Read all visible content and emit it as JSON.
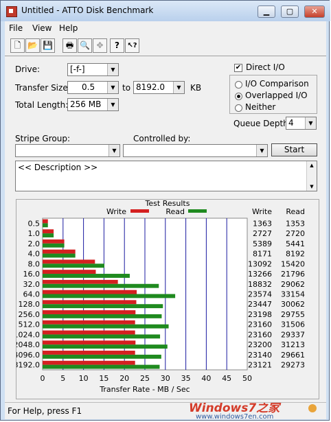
{
  "window": {
    "title": "Untitled - ATTO Disk Benchmark"
  },
  "menu": {
    "file": "File",
    "view": "View",
    "help": "Help"
  },
  "toolbar": {
    "icons": [
      "new-document-icon",
      "open-folder-icon",
      "save-icon",
      "print-icon",
      "print-preview-icon",
      "move-icon",
      "help-icon",
      "context-help-icon"
    ],
    "glyphs": [
      "🗋",
      "📂",
      "💾",
      "🖶",
      "🔍",
      "✥",
      "?",
      "↖?"
    ]
  },
  "form": {
    "drive_label": "Drive:",
    "drive_value": "[-f-]",
    "transfer_size_label": "Transfer Size:",
    "transfer_from": "0.5",
    "to_label": "to",
    "transfer_to": "8192.0",
    "kb_label": "KB",
    "total_length_label": "Total Length:",
    "total_length_value": "256 MB",
    "direct_io_label": "Direct I/O",
    "direct_io_checked": true,
    "io_comparison_label": "I/O Comparison",
    "overlapped_io_label": "Overlapped I/O",
    "neither_label": "Neither",
    "selected_mode": "Overlapped I/O",
    "queue_depth_label": "Queue Depth:",
    "queue_depth_value": "4",
    "stripe_group_label": "Stripe Group:",
    "controlled_by_label": "Controlled by:",
    "start_button": "Start",
    "description_text": "<< Description >>"
  },
  "results": {
    "title": "Test Results",
    "write_col": "Write",
    "read_col": "Read",
    "legend_write": "Write",
    "legend_read": "Read"
  },
  "chart_data": {
    "type": "bar",
    "orientation": "horizontal",
    "title": "Test Results",
    "xlabel": "Transfer Rate - MB / Sec",
    "xlim": [
      0,
      50
    ],
    "xticks": [
      "0",
      "5",
      "10",
      "15",
      "20",
      "25",
      "30",
      "35",
      "40",
      "45",
      "50"
    ],
    "categories": [
      "0.5",
      "1.0",
      "2.0",
      "4.0",
      "8.0",
      "16.0",
      "32.0",
      "64.0",
      "128.0",
      "256.0",
      "512.0",
      "1024.0",
      "2048.0",
      "4096.0",
      "8192.0"
    ],
    "series": [
      {
        "name": "Write",
        "color": "#d42020",
        "values": [
          1.3,
          2.7,
          5.3,
          8.0,
          12.8,
          13.0,
          18.4,
          23.0,
          22.9,
          22.7,
          22.6,
          22.6,
          22.7,
          22.6,
          22.6
        ]
      },
      {
        "name": "Read",
        "color": "#1f8a1f",
        "values": [
          1.3,
          2.7,
          5.3,
          8.0,
          15.1,
          21.3,
          28.4,
          32.4,
          29.4,
          29.1,
          30.8,
          28.7,
          30.5,
          29.0,
          28.6
        ]
      }
    ],
    "table_write": [
      "1363",
      "2727",
      "5389",
      "8171",
      "13092",
      "13266",
      "18832",
      "23574",
      "23447",
      "23198",
      "23160",
      "23160",
      "23200",
      "23140",
      "23121"
    ],
    "table_read": [
      "1353",
      "2720",
      "5441",
      "8192",
      "15420",
      "21796",
      "29062",
      "33154",
      "30062",
      "29755",
      "31506",
      "29337",
      "31213",
      "29661",
      "29273"
    ],
    "grid": true,
    "legend": "top"
  },
  "status": {
    "text": "For Help, press F1"
  },
  "watermark": {
    "line1": "Windows7之家",
    "line2": "www.windows7en.com"
  }
}
